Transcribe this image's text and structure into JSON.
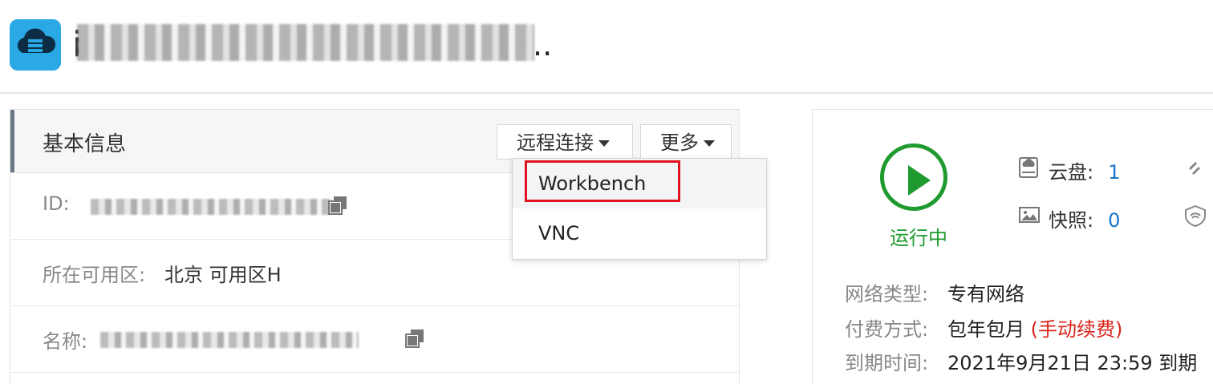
{
  "header": {
    "title_prefix": "i",
    "title_suffix": ".."
  },
  "basic_info": {
    "title": "基本信息",
    "remote_connect_label": "远程连接",
    "more_label": "更多",
    "rows": [
      {
        "label": "ID:",
        "value": ""
      },
      {
        "label": "所在可用区:",
        "value": "北京 可用区H"
      },
      {
        "label": "名称:",
        "value": ""
      }
    ]
  },
  "remote_menu": {
    "items": [
      "Workbench",
      "VNC"
    ],
    "highlighted": "Workbench"
  },
  "status": {
    "state": "运行中",
    "color": "#1e9a2e",
    "cloud_disk_label": "云盘:",
    "cloud_disk_count": "1",
    "snapshot_label": "快照:",
    "snapshot_count": "0",
    "network_type_label": "网络类型:",
    "network_type_value": "专有网络",
    "billing_label": "付费方式:",
    "billing_value": "包年包月",
    "billing_note": "(手动续费)",
    "expiry_label": "到期时间:",
    "expiry_value": "2021年9月21日 23:59 到期"
  },
  "colors": {
    "accent_blue": "#2aa9e6",
    "link_blue": "#1a73c8",
    "highlight_red": "#e0141e",
    "warn_red": "#d9241b"
  }
}
